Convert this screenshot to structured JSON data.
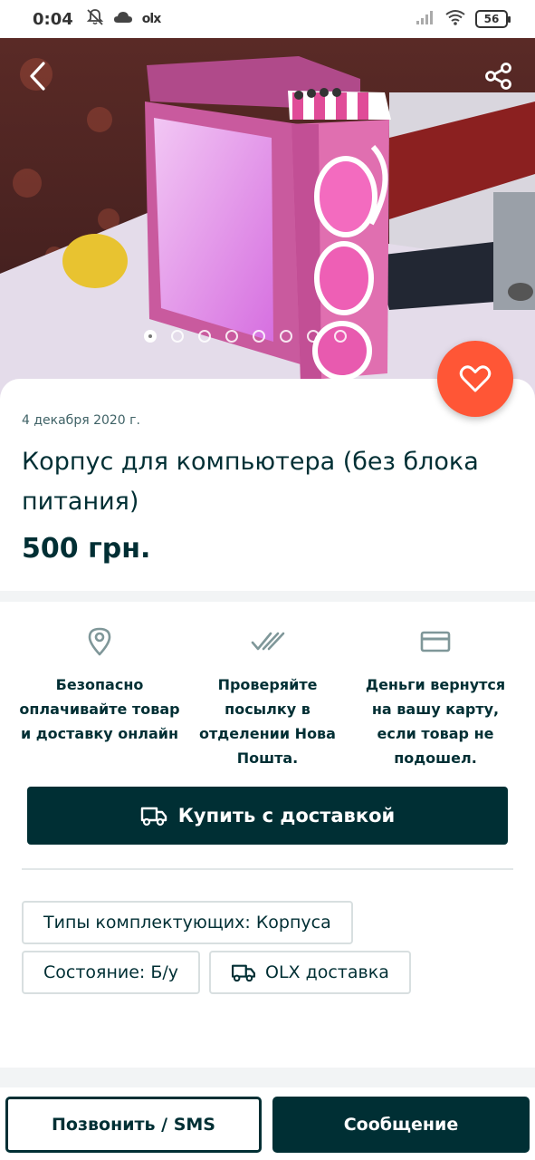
{
  "status_bar": {
    "time": "0:04",
    "battery": "56",
    "app_label": "olx"
  },
  "gallery": {
    "image_count": 8,
    "active_index": 0
  },
  "listing": {
    "date": "4 декабря 2020 г.",
    "title": "Корпус для компьютера (без блока питания)",
    "price": "500 грн."
  },
  "features": [
    {
      "icon": "location-pin-icon",
      "text": "Безопасно оплачивайте товар и доставку онлайн"
    },
    {
      "icon": "double-check-icon",
      "text": "Проверяйте посылку в отделении Нова Пошта."
    },
    {
      "icon": "credit-card-icon",
      "text": "Деньги вернутся на вашу карту, если товар не подошел."
    }
  ],
  "buy_button": {
    "label": "Купить с доставкой"
  },
  "tags": {
    "type": "Типы комплектующих: Корпуса",
    "condition": "Состояние: Б/у",
    "delivery": "OLX доставка"
  },
  "bottom_bar": {
    "call_label": "Позвонить / SMS",
    "message_label": "Сообщение"
  },
  "colors": {
    "brand_dark": "#002f34",
    "favorite": "#ff5636"
  }
}
